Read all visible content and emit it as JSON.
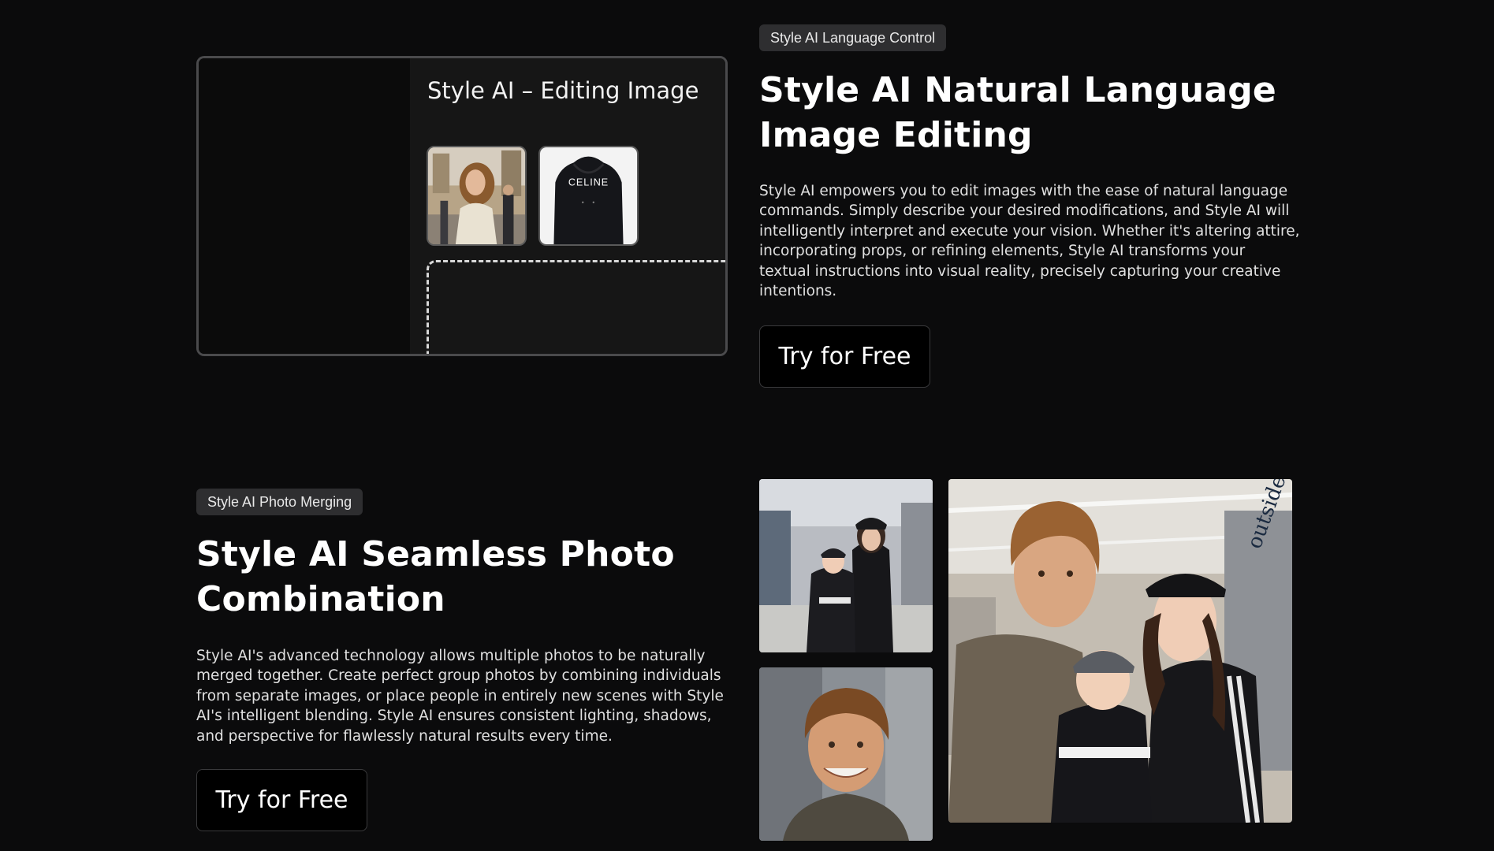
{
  "section1": {
    "badge": "Style AI Language Control",
    "title_line1": "Style AI Natural Language",
    "title_line2": "Image Editing",
    "desc_lines": [
      "Style AI empowers you to edit images with the ease of natural language",
      "commands. Simply describe your desired modifications, and Style AI will",
      "intelligently interpret and execute your vision. Whether it's altering attire,",
      "incorporating props, or refining elements, Style AI transforms your",
      "textual instructions into visual reality, precisely capturing your creative",
      "intentions."
    ],
    "cta": "Try for Free",
    "mockup": {
      "title": "Style AI – Editing Image",
      "hoodie_logo": "CELINE",
      "icons": [
        "arrow-cursor-icon",
        "cloud-upload-icon"
      ]
    }
  },
  "section2": {
    "badge": "Style AI Photo Merging",
    "title_line1": "Style AI Seamless Photo",
    "title_line2": "Combination",
    "desc_lines": [
      "Style AI's advanced technology allows multiple photos to be naturally",
      "merged together. Create perfect group photos by combining individuals",
      "from separate images, or place people in entirely new scenes with Style",
      "AI's intelligent blending. Style AI ensures consistent lighting, shadows,",
      "and perspective for flawlessly natural results every time."
    ],
    "cta": "Try for Free",
    "store_sign": "outsiders"
  },
  "colors": {
    "background": "#0b0b0c",
    "badge_bg": "#2e2e30",
    "button_bg": "#000000",
    "button_border": "#3a3a3c"
  }
}
